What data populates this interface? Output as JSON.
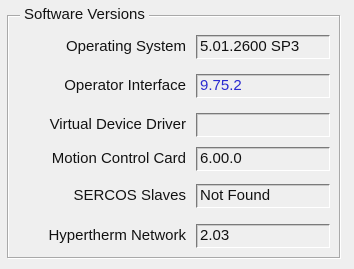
{
  "group": {
    "title": "Software Versions"
  },
  "rows": [
    {
      "label": "Operating System",
      "value": "5.01.2600 SP3",
      "value_color": "#111111"
    },
    {
      "label": "Operator Interface",
      "value": "9.75.2",
      "value_color": "#2a2ad0"
    },
    {
      "label": "Virtual Device Driver",
      "value": "",
      "value_color": "#111111"
    },
    {
      "label": "Motion Control Card",
      "value": "6.00.0",
      "value_color": "#111111"
    },
    {
      "label": "SERCOS Slaves",
      "value": "Not Found",
      "value_color": "#111111"
    },
    {
      "label": "Hypertherm Network",
      "value": "2.03",
      "value_color": "#111111"
    }
  ]
}
